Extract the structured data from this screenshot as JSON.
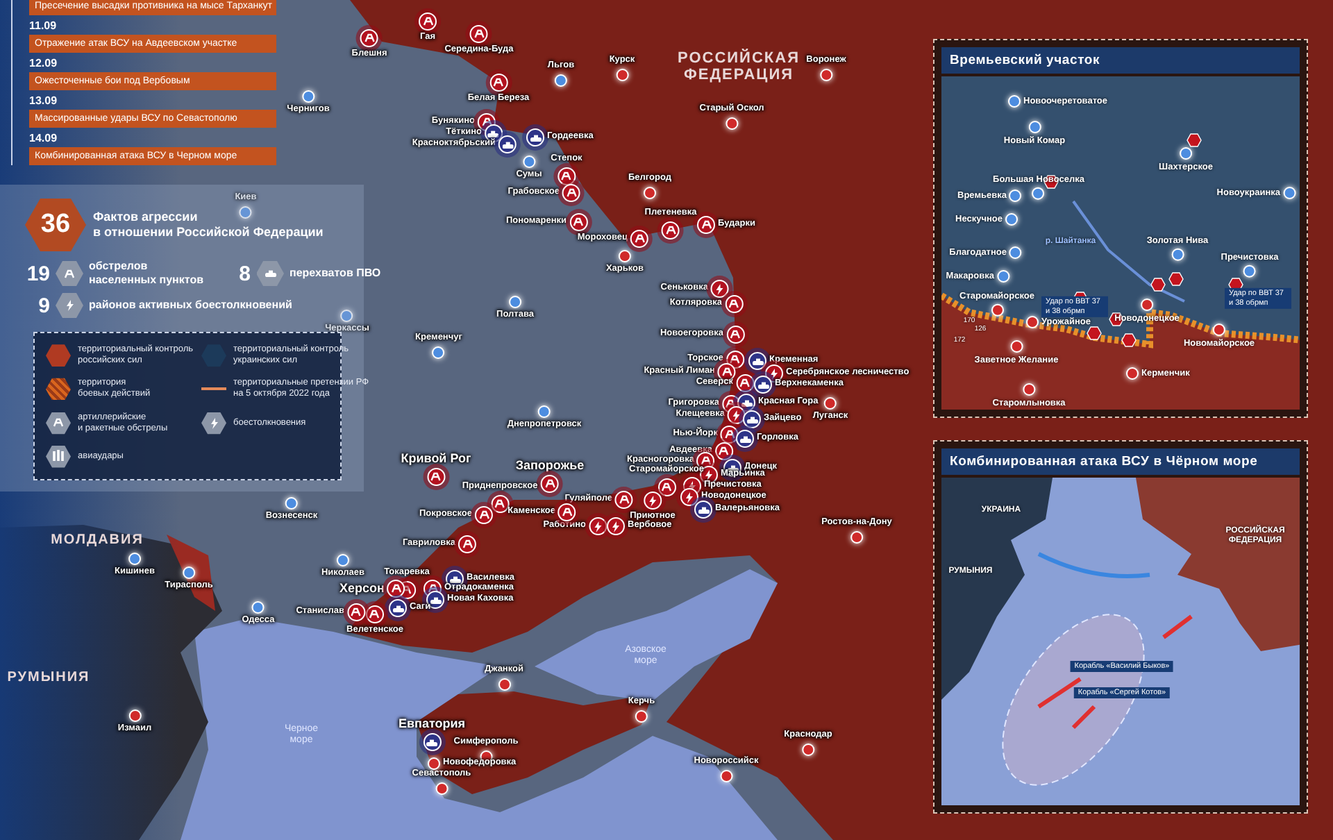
{
  "timeline": [
    {
      "text": "Пресечение высадки противника на мысе Тарханкут"
    },
    {
      "date": "11.09",
      "text": "Отражение атак ВСУ на Авдеевском участке"
    },
    {
      "date": "12.09",
      "text": "Ожесточенные бои под Вербовым"
    },
    {
      "date": "13.09",
      "text": "Массированные удары ВСУ по Севастополю"
    },
    {
      "date": "14.09",
      "text": "Комбинированная атака ВСУ в Черном море"
    }
  ],
  "summary": {
    "count": "36",
    "lines": [
      "Фактов агрессии",
      "в отношении Российской Федерации"
    ]
  },
  "stats": [
    {
      "kind": "shelling",
      "count": "19",
      "lines": [
        "обстрелов",
        "населенных пунктов"
      ]
    },
    {
      "kind": "air_defense",
      "count": "8",
      "lines": [
        "перехватов ПВО"
      ]
    },
    {
      "kind": "clash",
      "count": "9",
      "lines": [
        "районов активных боестолкновений"
      ]
    }
  ],
  "legend": [
    {
      "kind": "russian_control",
      "lines": [
        "территориальный контроль",
        "российских сил"
      ]
    },
    {
      "kind": "ukrainian_control",
      "lines": [
        "территориальный контроль",
        "украинских сил"
      ]
    },
    {
      "kind": "combat_zone",
      "lines": [
        "территория",
        "боевых действий"
      ]
    },
    {
      "kind": "claims_line",
      "lines": [
        "территориальные претензии РФ",
        "на 5 октября 2022 года"
      ]
    },
    {
      "kind": "artillery",
      "lines": [
        "артиллерийские",
        "и ракетные обстрелы"
      ]
    },
    {
      "kind": "clash",
      "lines": [
        "боестолкновения"
      ]
    },
    {
      "kind": "airstrike",
      "lines": [
        "авиаудары"
      ]
    }
  ],
  "map": {
    "countries": [
      {
        "lines": [
          "РОССИЙСКАЯ",
          "ФЕДЕРАЦИЯ"
        ]
      },
      {
        "lines": [
          "МОЛДАВИЯ"
        ]
      },
      {
        "lines": [
          "РУМЫНИЯ"
        ]
      }
    ],
    "seas": [
      {
        "lines": [
          "Азовское",
          "море"
        ]
      },
      {
        "lines": [
          "Черное",
          "море"
        ]
      }
    ],
    "cities": [
      {
        "name": "Курск"
      },
      {
        "name": "Льгов"
      },
      {
        "name": "Воронеж"
      },
      {
        "name": "Старый Оскол"
      },
      {
        "name": "Белгород"
      },
      {
        "name": "Сумы"
      },
      {
        "name": "Харьков"
      },
      {
        "name": "Полтава"
      },
      {
        "name": "Кременчуг"
      },
      {
        "name": "Днепропетровск"
      },
      {
        "name": "Луганск"
      },
      {
        "name": "Ростов-на-Дону"
      },
      {
        "name": "Джанкой"
      },
      {
        "name": "Керчь"
      },
      {
        "name": "Краснодар"
      },
      {
        "name": "Новороссийск"
      },
      {
        "name": "Симферополь"
      },
      {
        "name": "Севастополь"
      },
      {
        "name": "Новофедоровка"
      },
      {
        "name": "Чернигов"
      },
      {
        "name": "Киев"
      },
      {
        "name": "Черкассы"
      },
      {
        "name": "Вознесенск"
      },
      {
        "name": "Николаев"
      },
      {
        "name": "Одесса"
      },
      {
        "name": "Кишинев"
      },
      {
        "name": "Тирасполь"
      },
      {
        "name": "Измаил"
      }
    ],
    "events": [
      {
        "name": "Блешня",
        "kind": "artillery"
      },
      {
        "name": "Гая",
        "kind": "artillery"
      },
      {
        "name": "Середина-Буда",
        "kind": "artillery"
      },
      {
        "name": "Белая Береза",
        "kind": "artillery"
      },
      {
        "name": "Бунякино",
        "kind": "artillery"
      },
      {
        "name": "Тёткино",
        "kind": "air_defense"
      },
      {
        "name": "Красноктябрьский",
        "kind": "air_defense"
      },
      {
        "name": "Гордеевка",
        "kind": "air_defense"
      },
      {
        "name": "Степок",
        "kind": "artillery"
      },
      {
        "name": "Грабовское",
        "kind": "artillery"
      },
      {
        "name": "Пономаренки",
        "kind": "artillery"
      },
      {
        "name": "Мороховец",
        "kind": "artillery"
      },
      {
        "name": "Плетеневка",
        "kind": "artillery"
      },
      {
        "name": "Бударки",
        "kind": "artillery"
      },
      {
        "name": "Сеньковка",
        "kind": "clash"
      },
      {
        "name": "Котляровка",
        "kind": "artillery"
      },
      {
        "name": "Новоегоровка",
        "kind": "artillery"
      },
      {
        "name": "Торское",
        "kind": "artillery"
      },
      {
        "name": "Кременная",
        "kind": "air_defense"
      },
      {
        "name": "Красный Лиман",
        "kind": "artillery"
      },
      {
        "name": "Серебрянское лесничество",
        "kind": "clash"
      },
      {
        "name": "Северск",
        "kind": "artillery"
      },
      {
        "name": "Верхнекаменка",
        "kind": "air_defense"
      },
      {
        "name": "Григоровка",
        "kind": "artillery"
      },
      {
        "name": "Красная Гора",
        "kind": "air_defense"
      },
      {
        "name": "Клещеевка",
        "kind": "clash"
      },
      {
        "name": "Зайцево",
        "kind": "air_defense"
      },
      {
        "name": "Нью-Йорк",
        "kind": "artillery"
      },
      {
        "name": "Горловка",
        "kind": "air_defense"
      },
      {
        "name": "Авдеевка",
        "kind": "artillery"
      },
      {
        "name": "Красногоровка",
        "kind": "artillery"
      },
      {
        "name": "Донецк",
        "kind": "air_defense"
      },
      {
        "name": "Марьинка",
        "kind": "clash"
      },
      {
        "name": "Старомайорское",
        "kind": "artillery"
      },
      {
        "name": "Пречистовка",
        "kind": "clash"
      },
      {
        "name": "Гуляйполе",
        "kind": "artillery"
      },
      {
        "name": "Новодонецкое",
        "kind": "clash"
      },
      {
        "name": "Приютное",
        "kind": "clash"
      },
      {
        "name": "Валерьяновка",
        "kind": "air_defense"
      },
      {
        "name": "Работино",
        "kind": "clash"
      },
      {
        "name": "Вербовое",
        "kind": "clash"
      },
      {
        "name": "Запорожье",
        "kind": "artillery"
      },
      {
        "name": "Кривой Рог",
        "kind": "artillery"
      },
      {
        "name": "Приднепровское",
        "kind": "artillery"
      },
      {
        "name": "Покровское",
        "kind": "artillery"
      },
      {
        "name": "Каменское",
        "kind": "artillery"
      },
      {
        "name": "Гавриловка",
        "kind": "artillery"
      },
      {
        "name": "Токаревка",
        "kind": "artillery"
      },
      {
        "name": "Василевка",
        "kind": "air_defense"
      },
      {
        "name": "Херсон",
        "kind": "artillery"
      },
      {
        "name": "Отрадокаменка",
        "kind": "artillery"
      },
      {
        "name": "Новая Каховка",
        "kind": "air_defense"
      },
      {
        "name": "Саги",
        "kind": "air_defense"
      },
      {
        "name": "Велетенское",
        "kind": "artillery"
      },
      {
        "name": "Станислав",
        "kind": "artillery"
      },
      {
        "name": "Евпатория",
        "kind": "air_defense"
      }
    ]
  },
  "insets": [
    {
      "title": "Времьевский участок",
      "kind": "front",
      "places": [
        {
          "name": "Новоочеретоватое"
        },
        {
          "name": "Новый Комар"
        },
        {
          "name": "Большая Новоселка"
        },
        {
          "name": "Времьевка"
        },
        {
          "name": "Нескучное"
        },
        {
          "name": "Благодатное"
        },
        {
          "name": "Макаровка"
        },
        {
          "name": "Старомайорское"
        },
        {
          "name": "Урожайное"
        },
        {
          "name": "Заветное Желание"
        },
        {
          "name": "Старомлыновка"
        },
        {
          "name": "Шахтерское"
        },
        {
          "name": "Новоукраинка"
        },
        {
          "name": "Золотая Нива"
        },
        {
          "name": "Пречистовка"
        },
        {
          "name": "Новодонецкое"
        },
        {
          "name": "Новомайорское"
        },
        {
          "name": "Керменчик"
        }
      ],
      "notes": [
        {
          "kind": "river",
          "text": "р. Шайтанка"
        },
        {
          "kind": "callout",
          "text": "Удар по ВВТ 37 и 38 обрмп"
        },
        {
          "kind": "callout",
          "text": "Удар по ВВТ 37 и 38 обрмп"
        },
        {
          "kind": "height",
          "text": "170"
        },
        {
          "kind": "height",
          "text": "126"
        },
        {
          "kind": "height",
          "text": "172"
        }
      ]
    },
    {
      "title": "Комбинированная атака ВСУ в Чёрном море",
      "kind": "sea",
      "places": [
        {
          "name": "УКРАИНА"
        },
        {
          "name": "РУМЫНИЯ"
        },
        {
          "name": "РОССИЙСКАЯ ФЕДЕРАЦИЯ"
        }
      ],
      "notes": [
        {
          "kind": "callout",
          "text": "Корабль «Василий Быков»"
        },
        {
          "kind": "callout",
          "text": "Корабль «Сергей Котов»"
        }
      ]
    }
  ]
}
